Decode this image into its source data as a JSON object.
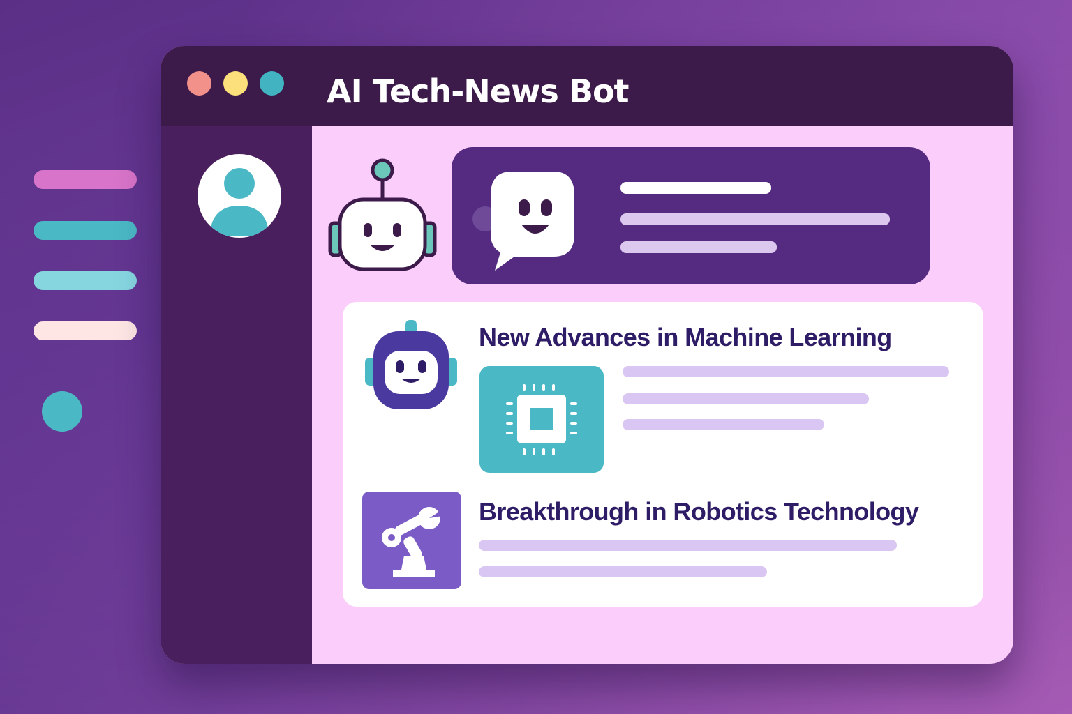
{
  "app": {
    "title": "AI Tech-News Bot"
  },
  "colors": {
    "background": "#6a3a96",
    "titlebar": "#3c1a4a",
    "sidebar": "#4a1f5e",
    "content": "#fbcdfa",
    "bubble_card": "#542b80",
    "headline_text": "#2e1d66",
    "accent_teal": "#4bb8c5",
    "accent_purple": "#7b5cc6"
  },
  "window_controls": [
    {
      "name": "close",
      "color": "#f2918a"
    },
    {
      "name": "minimize",
      "color": "#fbe07c"
    },
    {
      "name": "zoom",
      "color": "#41b3c1"
    }
  ],
  "decorative_bars": [
    "#d874c9",
    "#4bb8c5",
    "#86d6e0",
    "#fde6e4"
  ],
  "chat": {
    "bot_icon": "robot-icon",
    "bubble_icon": "chat-bubble-icon"
  },
  "news": [
    {
      "title": "New Advances in Machine Learning",
      "icon": "robot-icon",
      "thumbnail_icon": "chip-icon"
    },
    {
      "title": "Breakthrough in Robotics Technology",
      "thumbnail_icon": "robotic-arm-icon"
    }
  ]
}
